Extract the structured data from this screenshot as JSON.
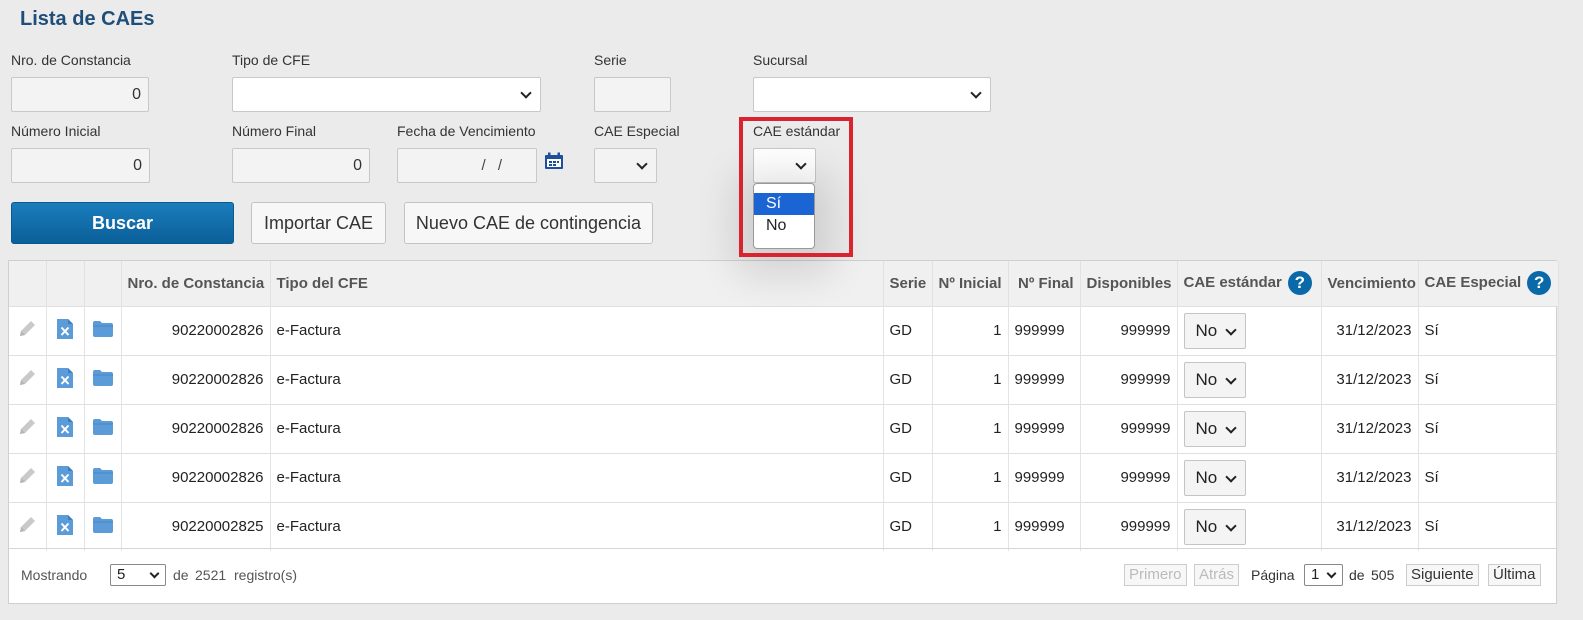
{
  "page_title": "Lista de CAEs",
  "filters": {
    "nro_constancia": {
      "label": "Nro. de Constancia",
      "value": "0"
    },
    "tipo_cfe": {
      "label": "Tipo de CFE",
      "value": ""
    },
    "serie": {
      "label": "Serie",
      "value": ""
    },
    "sucursal": {
      "label": "Sucursal",
      "value": ""
    },
    "numero_inicial": {
      "label": "Número Inicial",
      "value": "0"
    },
    "numero_final": {
      "label": "Número Final",
      "value": "0"
    },
    "fecha_vencimiento": {
      "label": "Fecha de Vencimiento",
      "value": "/ /"
    },
    "cae_especial": {
      "label": "CAE Especial",
      "value": ""
    },
    "cae_estandar": {
      "label": "CAE estándar",
      "value": "",
      "options": [
        "Sí",
        "No"
      ],
      "highlighted": "Sí"
    }
  },
  "buttons": {
    "search": "Buscar",
    "import": "Importar CAE",
    "new_contingency": "Nuevo CAE de contingencia"
  },
  "table": {
    "headers": {
      "nro_constancia": "Nro. de Constancia",
      "tipo": "Tipo del CFE",
      "serie": "Serie",
      "n_inicial": "Nº Inicial",
      "n_final": "Nº Final",
      "disponibles": "Disponibles",
      "cae_estandar": "CAE estándar",
      "vencimiento": "Vencimiento",
      "cae_especial": "CAE Especial"
    },
    "rows": [
      {
        "nro": "90220002826",
        "tipo": "e-Factura",
        "serie": "GD",
        "inicial": "1",
        "final": "999999",
        "disponibles": "999999",
        "estandar": "No",
        "vencimiento": "31/12/2023",
        "especial": "Sí"
      },
      {
        "nro": "90220002826",
        "tipo": "e-Factura",
        "serie": "GD",
        "inicial": "1",
        "final": "999999",
        "disponibles": "999999",
        "estandar": "No",
        "vencimiento": "31/12/2023",
        "especial": "Sí"
      },
      {
        "nro": "90220002826",
        "tipo": "e-Factura",
        "serie": "GD",
        "inicial": "1",
        "final": "999999",
        "disponibles": "999999",
        "estandar": "No",
        "vencimiento": "31/12/2023",
        "especial": "Sí"
      },
      {
        "nro": "90220002826",
        "tipo": "e-Factura",
        "serie": "GD",
        "inicial": "1",
        "final": "999999",
        "disponibles": "999999",
        "estandar": "No",
        "vencimiento": "31/12/2023",
        "especial": "Sí"
      },
      {
        "nro": "90220002825",
        "tipo": "e-Factura",
        "serie": "GD",
        "inicial": "1",
        "final": "999999",
        "disponibles": "999999",
        "estandar": "No",
        "vencimiento": "31/12/2023",
        "especial": "Sí"
      }
    ],
    "help_glyph": "?"
  },
  "footer": {
    "showing_label": "Mostrando",
    "page_size": "5",
    "of_label": "de",
    "total_records": "2521",
    "records_suffix": "registro(s)",
    "first": "Primero",
    "prev": "Atrás",
    "page_label": "Página",
    "current_page": "1",
    "of_pages_label": "de",
    "total_pages": "505",
    "next": "Siguiente",
    "last": "Última"
  },
  "colors": {
    "title": "#1e4f7a",
    "primary_button": "#0a6aaa",
    "highlight_box": "#d9232e",
    "icon_blue": "#5b9bd8"
  }
}
